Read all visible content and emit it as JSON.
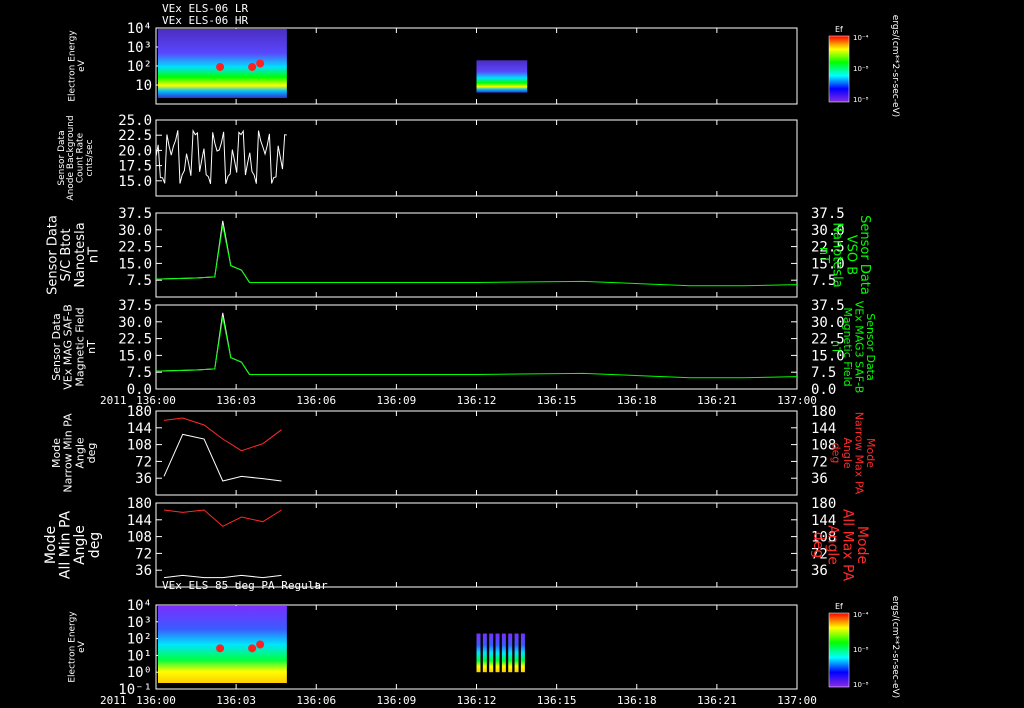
{
  "chart_data": [
    {
      "type": "heatmap",
      "title_lines": [
        "VEx ELS-06 LR",
        "VEx ELS-06 HR"
      ],
      "ylabel_lines": [
        "Electron Energy",
        "eV"
      ],
      "y_scale": "log",
      "ylim": [
        1,
        10000
      ],
      "yticks": [
        {
          "v": 10000,
          "l": "10⁴"
        },
        {
          "v": 1000,
          "l": "10³"
        },
        {
          "v": 100,
          "l": "10²"
        },
        {
          "v": 10,
          "l": "10"
        }
      ],
      "colorbar": {
        "label": "Ef",
        "ticks": [
          "10⁻⁴",
          "10⁻⁸",
          "10⁻⁸"
        ],
        "units": "ergs/(cm**2-sr-sec-eV)"
      },
      "blocks": [
        {
          "x": [
            0,
            4.9
          ]
        },
        {
          "x": [
            12.0,
            13.9
          ],
          "y": [
            4,
            200
          ]
        }
      ]
    },
    {
      "type": "line",
      "ylabel_lines": [
        "Sensor Data",
        "Anode Background",
        "Count Rate",
        "cnts/sec"
      ],
      "ylim": [
        12.5,
        25.0
      ],
      "yticks": [
        {
          "v": 25.0,
          "l": "25.0"
        },
        {
          "v": 22.5,
          "l": "22.5"
        },
        {
          "v": 20.0,
          "l": "20.0"
        },
        {
          "v": 17.5,
          "l": "17.5"
        },
        {
          "v": 15.0,
          "l": "15.0"
        }
      ],
      "series": [
        {
          "color": "#ffffff",
          "x_range": [
            0,
            4.9
          ],
          "values_range": [
            14.5,
            23.5
          ]
        }
      ]
    },
    {
      "type": "line",
      "ylabel_lines": [
        "Sensor Data",
        "S/C Btot",
        "Nanotesla",
        "nT"
      ],
      "right_label_lines": [
        "Sensor Data",
        "VSO B",
        "Nanotesla",
        "nT"
      ],
      "ylim": [
        0,
        37.5
      ],
      "yticks": [
        {
          "v": 37.5,
          "l": "37.5"
        },
        {
          "v": 30.0,
          "l": "30.0"
        },
        {
          "v": 22.5,
          "l": "22.5"
        },
        {
          "v": 15.0,
          "l": "15.0"
        },
        {
          "v": 7.5,
          "l": "7.5"
        }
      ],
      "series": [
        {
          "color": "#ffffff",
          "x": [
            0,
            1.5,
            2.2,
            2.5,
            2.8,
            3.2,
            3.5,
            4.9
          ],
          "y": [
            8,
            8.5,
            9,
            34,
            14,
            12,
            6.5,
            6.5
          ]
        },
        {
          "color": "#00ff00",
          "x": [
            0,
            1.5,
            2.2,
            2.5,
            2.8,
            3.2,
            3.5,
            8,
            12,
            16,
            20,
            22,
            24
          ],
          "y": [
            8,
            8.5,
            9,
            32,
            14,
            12,
            6.5,
            6.5,
            6.5,
            7.0,
            5.0,
            5.0,
            5.5
          ]
        }
      ]
    },
    {
      "type": "line",
      "ylabel_lines": [
        "Sensor Data",
        "VEx MAG SAF-B",
        "Magnetic Field",
        "nT"
      ],
      "right_label_lines": [
        "Sensor Data",
        "VEx MAG3 SAF-B",
        "Magnetic Field",
        "nT"
      ],
      "ylim": [
        0,
        37.5
      ],
      "yticks": [
        {
          "v": 37.5,
          "l": "37.5"
        },
        {
          "v": 30.0,
          "l": "30.0"
        },
        {
          "v": 22.5,
          "l": "22.5"
        },
        {
          "v": 15.0,
          "l": "15.0"
        },
        {
          "v": 7.5,
          "l": "7.5"
        },
        {
          "v": 0.0,
          "l": "0.0"
        }
      ],
      "series": [
        {
          "color": "#ffffff",
          "x": [
            0,
            1.5,
            2.2,
            2.5,
            2.8,
            3.2,
            3.5,
            4.9
          ],
          "y": [
            8,
            8.5,
            9,
            34,
            14,
            12,
            6.5,
            6.5
          ]
        },
        {
          "color": "#00ff00",
          "x": [
            0,
            1.5,
            2.2,
            2.5,
            2.8,
            3.2,
            3.5,
            8,
            12,
            16,
            20,
            22,
            24
          ],
          "y": [
            8,
            8.5,
            9,
            32,
            14,
            12,
            6.5,
            6.5,
            6.5,
            7.0,
            5.0,
            5.0,
            5.5
          ]
        }
      ]
    },
    {
      "type": "line",
      "ylabel_lines": [
        "Mode",
        "Narrow Min PA",
        "Angle",
        "deg"
      ],
      "right_label_lines": [
        "Mode",
        "Narrow Max PA",
        "Angle",
        "deg"
      ],
      "ylim": [
        0,
        180
      ],
      "yticks": [
        {
          "v": 180,
          "l": "180"
        },
        {
          "v": 144,
          "l": "144"
        },
        {
          "v": 108,
          "l": "108"
        },
        {
          "v": 72,
          "l": "72"
        },
        {
          "v": 36,
          "l": "36"
        }
      ],
      "series": [
        {
          "color": "#ffffff",
          "x": [
            0.3,
            1.0,
            1.8,
            2.5,
            3.2,
            4.0,
            4.7
          ],
          "y": [
            40,
            130,
            120,
            30,
            40,
            35,
            30
          ]
        },
        {
          "color": "#ff2a2a",
          "x": [
            0.3,
            1.0,
            1.8,
            2.5,
            3.2,
            4.0,
            4.7
          ],
          "y": [
            160,
            165,
            150,
            120,
            95,
            110,
            140
          ]
        }
      ]
    },
    {
      "type": "line",
      "ylabel_lines": [
        "Mode",
        "All Min PA",
        "Angle",
        "deg"
      ],
      "right_label_lines": [
        "Mode",
        "All Max PA",
        "Angle",
        "deg"
      ],
      "ylim": [
        0,
        180
      ],
      "yticks": [
        {
          "v": 180,
          "l": "180"
        },
        {
          "v": 144,
          "l": "144"
        },
        {
          "v": 108,
          "l": "108"
        },
        {
          "v": 72,
          "l": "72"
        },
        {
          "v": 36,
          "l": "36"
        }
      ],
      "series": [
        {
          "color": "#ffffff",
          "x": [
            0.3,
            1.0,
            1.8,
            2.5,
            3.2,
            4.0,
            4.7
          ],
          "y": [
            20,
            25,
            20,
            20,
            25,
            20,
            25
          ]
        },
        {
          "color": "#ff2a2a",
          "x": [
            0.3,
            1.0,
            1.8,
            2.5,
            3.2,
            4.0,
            4.7
          ],
          "y": [
            165,
            160,
            165,
            130,
            150,
            140,
            165
          ]
        }
      ]
    },
    {
      "type": "heatmap",
      "title_lines": [
        "VEx ELS 85 deg PA Regular"
      ],
      "ylabel_lines": [
        "Electron Energy",
        "eV"
      ],
      "y_scale": "log",
      "ylim": [
        0.1,
        10000
      ],
      "yticks": [
        {
          "v": 10000,
          "l": "10⁴"
        },
        {
          "v": 1000,
          "l": "10³"
        },
        {
          "v": 100,
          "l": "10²"
        },
        {
          "v": 10,
          "l": "10¹"
        },
        {
          "v": 1,
          "l": "10⁰"
        },
        {
          "v": 0.1,
          "l": "10⁻¹"
        }
      ],
      "colorbar": {
        "label": "Ef",
        "ticks": [
          "10⁻⁴",
          "10⁻⁸",
          "10⁻⁸"
        ],
        "units": "ergs/(cm**2-sr-sec-eV)"
      },
      "blocks": [
        {
          "x": [
            0,
            4.9
          ]
        },
        {
          "x": [
            12.0,
            13.9
          ],
          "y": [
            1,
            200
          ]
        }
      ]
    }
  ],
  "x_axis": {
    "year": "2011",
    "ticks": [
      {
        "v": 0,
        "l": "136:00"
      },
      {
        "v": 3,
        "l": "136:03"
      },
      {
        "v": 6,
        "l": "136:06"
      },
      {
        "v": 9,
        "l": "136:09"
      },
      {
        "v": 12,
        "l": "136:12"
      },
      {
        "v": 15,
        "l": "136:15"
      },
      {
        "v": 18,
        "l": "136:18"
      },
      {
        "v": 21,
        "l": "136:21"
      },
      {
        "v": 24,
        "l": "137:00"
      }
    ],
    "xlim": [
      0,
      24
    ]
  }
}
